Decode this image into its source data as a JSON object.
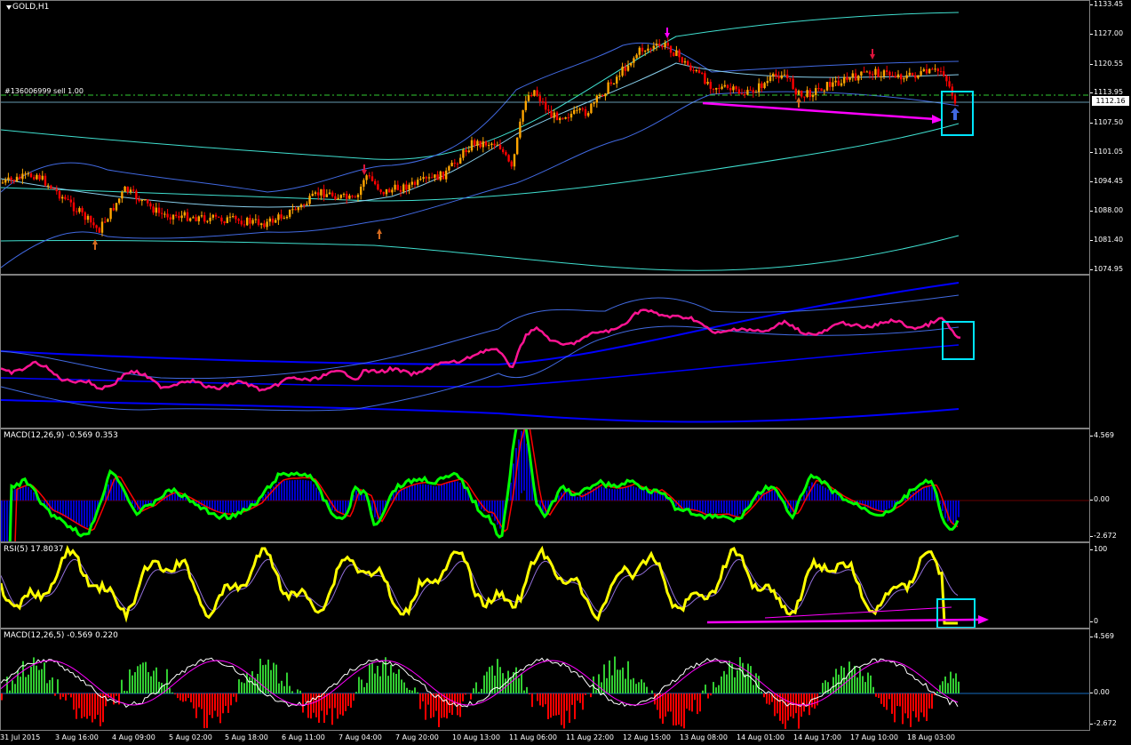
{
  "main": {
    "title": "GOLD,H1",
    "order_label": "#136006999 sell 1.00",
    "price_ticks": [
      "1133.45",
      "1127.00",
      "1120.55",
      "1113.95",
      "1107.50",
      "1101.05",
      "1094.45",
      "1088.00",
      "1081.40",
      "1074.95"
    ],
    "current_price": "1112.16"
  },
  "panes": {
    "indicator2": {
      "label": ""
    },
    "macd1": {
      "label": "MACD(12,26,9) -0.569 0.353",
      "ticks": [
        "4.569",
        "0.00",
        "-2.672"
      ]
    },
    "rsi": {
      "label": "RSI(5) 17.8037",
      "ticks": [
        "100",
        "0"
      ]
    },
    "macd2": {
      "label": "MACD(12,26,5) -0.569 0.220",
      "ticks": [
        "4.569",
        "0.00",
        "-2.672"
      ]
    }
  },
  "time_axis": [
    "31 Jul 2015",
    "3 Aug 16:00",
    "4 Aug 09:00",
    "5 Aug 02:00",
    "5 Aug 18:00",
    "6 Aug 11:00",
    "7 Aug 04:00",
    "7 Aug 20:00",
    "10 Aug 13:00",
    "11 Aug 06:00",
    "11 Aug 22:00",
    "12 Aug 15:00",
    "13 Aug 08:00",
    "14 Aug 01:00",
    "14 Aug 17:00",
    "17 Aug 10:00",
    "18 Aug 03:00"
  ],
  "colors": {
    "background": "#000000",
    "bull_candle": "#ffa500",
    "bear_candle": "#ff0000",
    "bands_outer": "#40e0d0",
    "bands_inner": "#4169e1",
    "highlight_box": "#00e5ff",
    "arrow_magenta": "#ff00ff",
    "rsi_line": "#ffff00",
    "macd_fast": "#00ff00",
    "indicator_line": "#ff1493"
  }
}
